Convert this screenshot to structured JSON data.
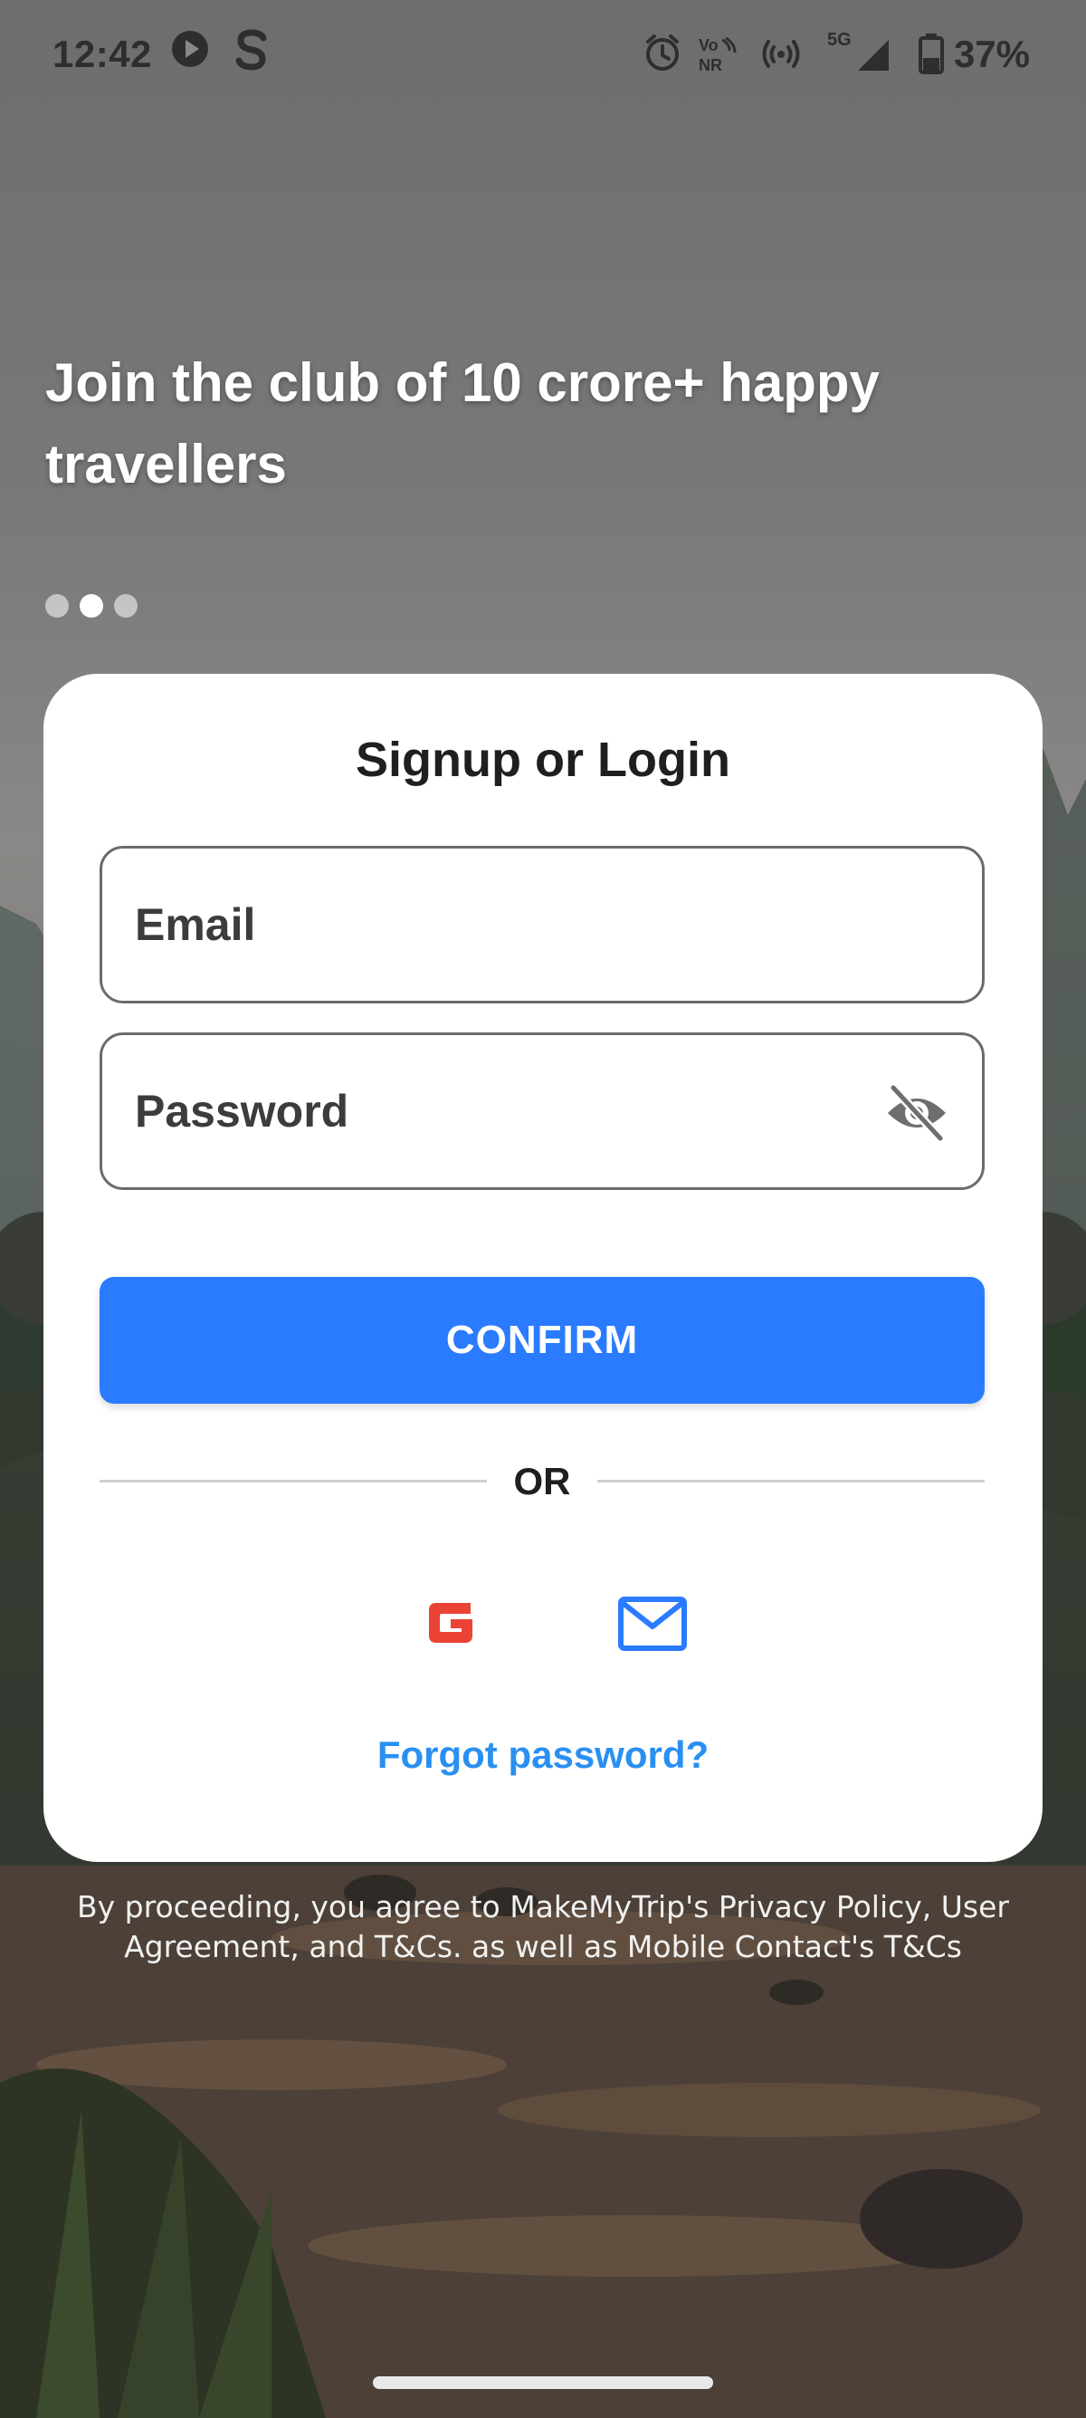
{
  "status_bar": {
    "time": "12:42",
    "battery_percent": "37%",
    "network_label": "5G",
    "icons": [
      "play-icon",
      "s-app-icon",
      "alarm-icon",
      "vonr-icon",
      "hotspot-icon",
      "signal-icon",
      "battery-icon"
    ]
  },
  "hero": {
    "title": "Join the club of 10 crore+ happy travellers",
    "carousel": {
      "total": 3,
      "active_index": 1
    }
  },
  "login_card": {
    "title": "Signup or Login",
    "email_placeholder": "Email",
    "password_placeholder": "Password",
    "confirm_label": "CONFIRM",
    "or_label": "OR",
    "social_icons": [
      "google-icon",
      "mail-icon"
    ],
    "forgot_password_label": "Forgot password?"
  },
  "footer": {
    "terms_text": "By proceeding, you agree to MakeMyTrip's Privacy Policy, User Agreement, and T&Cs. as well as Mobile Contact's T&Cs"
  },
  "colors": {
    "accent": "#2a7bff",
    "link": "#2a8ff2",
    "google_red": "#ea4335"
  }
}
